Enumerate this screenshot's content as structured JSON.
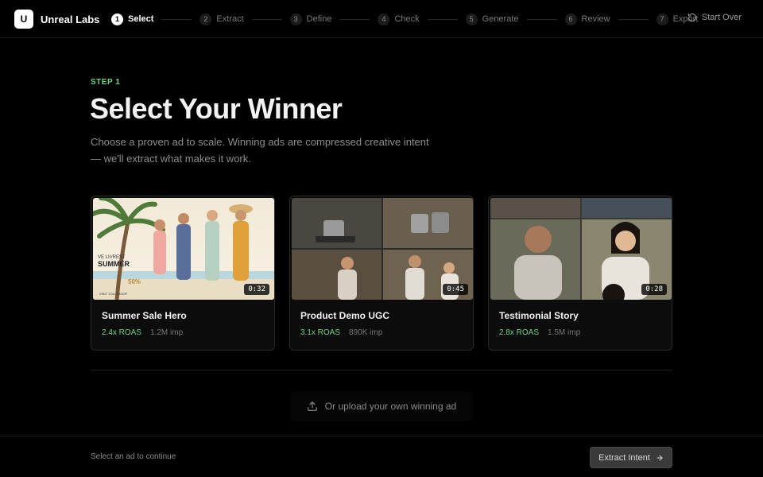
{
  "brand": {
    "logo_letter": "U",
    "name": "Unreal Labs"
  },
  "steps": [
    {
      "num": "1",
      "label": "Select",
      "active": true
    },
    {
      "num": "2",
      "label": "Extract",
      "active": false
    },
    {
      "num": "3",
      "label": "Define",
      "active": false
    },
    {
      "num": "4",
      "label": "Check",
      "active": false
    },
    {
      "num": "5",
      "label": "Generate",
      "active": false
    },
    {
      "num": "6",
      "label": "Review",
      "active": false
    },
    {
      "num": "7",
      "label": "Export",
      "active": false
    }
  ],
  "header": {
    "start_over": "Start Over"
  },
  "hero": {
    "step_label": "STEP 1",
    "title": "Select Your Winner",
    "subtitle": "Choose a proven ad to scale. Winning ads are compressed creative intent — we'll extract what makes it work."
  },
  "cards": [
    {
      "title": "Summer Sale Hero",
      "roas": "2.4x ROAS",
      "impressions": "1.2M imp",
      "duration": "0:32",
      "thumb_text": {
        "line1": "VE LIVREST",
        "line2": "SUMMER",
        "badge": "50%",
        "shop": "VISIT YOU SHOOP"
      }
    },
    {
      "title": "Product Demo UGC",
      "roas": "3.1x ROAS",
      "impressions": "890K imp",
      "duration": "0:45"
    },
    {
      "title": "Testimonial Story",
      "roas": "2.8x ROAS",
      "impressions": "1.5M imp",
      "duration": "0:28"
    }
  ],
  "upload": {
    "label": "Or upload your own winning ad"
  },
  "footer": {
    "hint": "Select an ad to continue",
    "cta_label": "Extract Intent"
  },
  "colors": {
    "accent_green": "#6fd483",
    "background": "#000000",
    "card_bg": "#0c0c0c"
  },
  "icons": {
    "start_over": "rotate-ccw-icon",
    "upload": "upload-icon",
    "cta": "arrow-right-icon"
  }
}
